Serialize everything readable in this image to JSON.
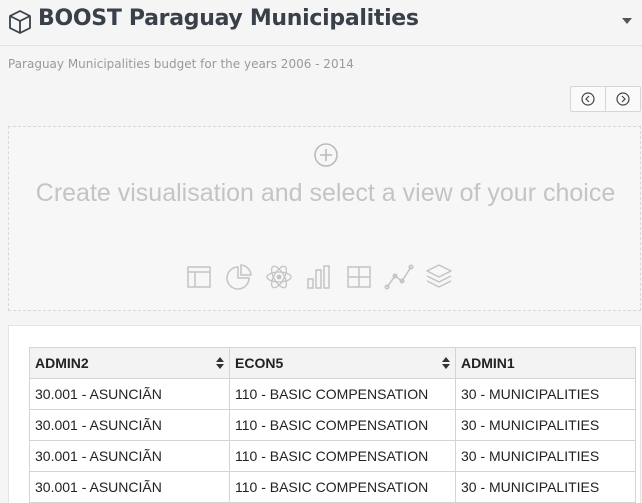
{
  "header": {
    "title": "BOOST Paraguay Municipalities",
    "subtitle": "Paraguay Municipalities budget for the years 2006 - 2014"
  },
  "visualisation": {
    "prompt": "Create visualisation and select a view of your choice",
    "view_icons": [
      "table-icon",
      "pie-chart-icon",
      "atom-icon",
      "bar-chart-icon",
      "grid-icon",
      "line-chart-icon",
      "layers-icon"
    ]
  },
  "table": {
    "columns": [
      "ADMIN2",
      "ECON5",
      "ADMIN1"
    ],
    "rows": [
      [
        "30.001 - ASUNCIÃN",
        "110 - BASIC COMPENSATION",
        "30 - MUNICIPALITIES"
      ],
      [
        "30.001 - ASUNCIÃN",
        "110 - BASIC COMPENSATION",
        "30 - MUNICIPALITIES"
      ],
      [
        "30.001 - ASUNCIÃN",
        "110 - BASIC COMPENSATION",
        "30 - MUNICIPALITIES"
      ],
      [
        "30.001 - ASUNCIÃN",
        "110 - BASIC COMPENSATION",
        "30 - MUNICIPALITIES"
      ]
    ]
  },
  "colors": {
    "title": "#3a4049",
    "muted": "#9a9a9a",
    "icon_gray": "#c4c4c4",
    "border": "#d4d4d4"
  }
}
